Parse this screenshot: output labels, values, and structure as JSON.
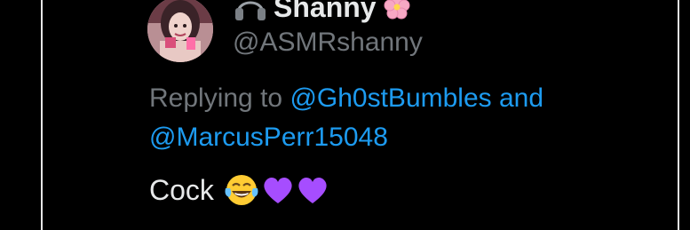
{
  "tweet": {
    "display_name": "Shanny",
    "handle": "@ASMRshanny",
    "reply_prefix": "Replying to",
    "reply_mention_1": "@Gh0stBumbles",
    "reply_joiner": "and",
    "reply_mention_2": "@MarcusPerr15048",
    "text": "Cock",
    "emojis": [
      "face-with-tears-of-joy-emoji",
      "purple-heart-emoji",
      "purple-heart-emoji"
    ],
    "name_icons": [
      "headphones-icon",
      "cherry-blossom-icon"
    ]
  },
  "colors": {
    "background": "#000000",
    "primary_text": "#e7e9ea",
    "secondary_text": "#71767b",
    "mention": "#1d9bf0",
    "purple_heart": "#a64dff"
  }
}
